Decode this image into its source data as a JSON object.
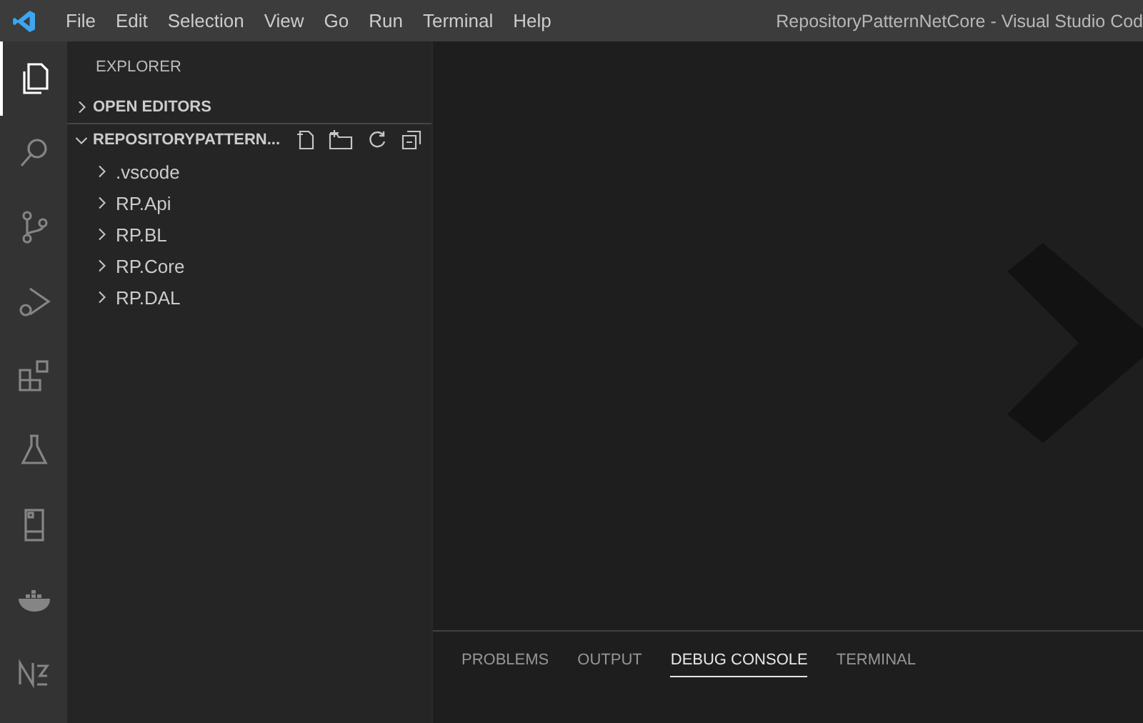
{
  "menu": [
    "File",
    "Edit",
    "Selection",
    "View",
    "Go",
    "Run",
    "Terminal",
    "Help"
  ],
  "window": {
    "title": "RepositoryPatternNetCore - Visual Studio Cod"
  },
  "activity_bar": [
    {
      "kind": "files",
      "selected": true
    },
    {
      "kind": "search",
      "selected": false
    },
    {
      "kind": "source-control",
      "selected": false
    },
    {
      "kind": "debug",
      "selected": false
    },
    {
      "kind": "extensions",
      "selected": false
    },
    {
      "kind": "flask",
      "selected": false
    },
    {
      "kind": "device",
      "selected": false
    },
    {
      "kind": "docker",
      "selected": false
    },
    {
      "kind": "n2",
      "selected": false
    }
  ],
  "sidebar": {
    "title": "EXPLORER",
    "sections": [
      {
        "label": "OPEN EDITORS",
        "expanded": false,
        "actions": false
      },
      {
        "label": "REPOSITORYPATTERN...",
        "expanded": true,
        "actions": true,
        "items": [
          {
            "label": ".vscode",
            "expanded": false
          },
          {
            "label": "RP.Api",
            "expanded": false
          },
          {
            "label": "RP.BL",
            "expanded": false
          },
          {
            "label": "RP.Core",
            "expanded": false
          },
          {
            "label": "RP.DAL",
            "expanded": false
          }
        ]
      }
    ]
  },
  "panel": {
    "tabs": [
      {
        "label": "PROBLEMS",
        "selected": false
      },
      {
        "label": "OUTPUT",
        "selected": false
      },
      {
        "label": "DEBUG CONSOLE",
        "selected": true
      },
      {
        "label": "TERMINAL",
        "selected": false
      }
    ]
  }
}
